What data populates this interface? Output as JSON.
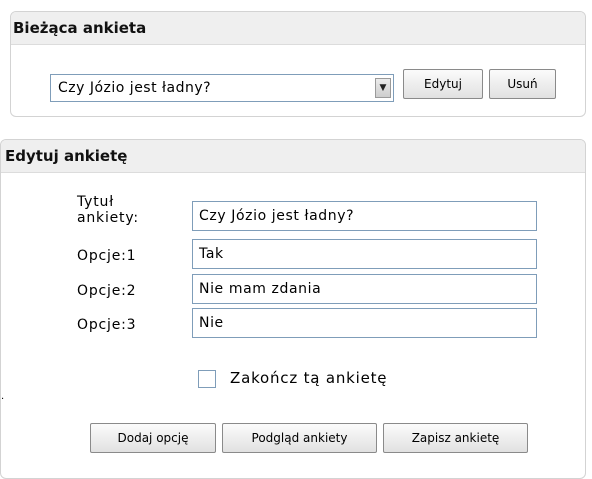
{
  "current_poll": {
    "header": "Bieżąca ankieta",
    "select_value": "Czy Józio jest ładny?",
    "edit_button": "Edytuj",
    "delete_button": "Usuń"
  },
  "edit_poll": {
    "header": "Edytuj ankietę",
    "title_label_line1": "Tytuł",
    "title_label_line2": "ankiety:",
    "title_value": "Czy Józio jest ładny?",
    "options": [
      {
        "label": "Opcje:1",
        "value": "Tak"
      },
      {
        "label": "Opcje:2",
        "value": "Nie mam zdania"
      },
      {
        "label": "Opcje:3",
        "value": "Nie"
      }
    ],
    "finish_checkbox_label": "Zakończ tą ankietę",
    "finish_checked": false,
    "add_option_button": "Dodaj opcję",
    "preview_button": "Podgląd ankiety",
    "save_button": "Zapisz ankietę"
  },
  "icons": {
    "dropdown": "chevron-down-icon"
  },
  "margin_mark": "."
}
